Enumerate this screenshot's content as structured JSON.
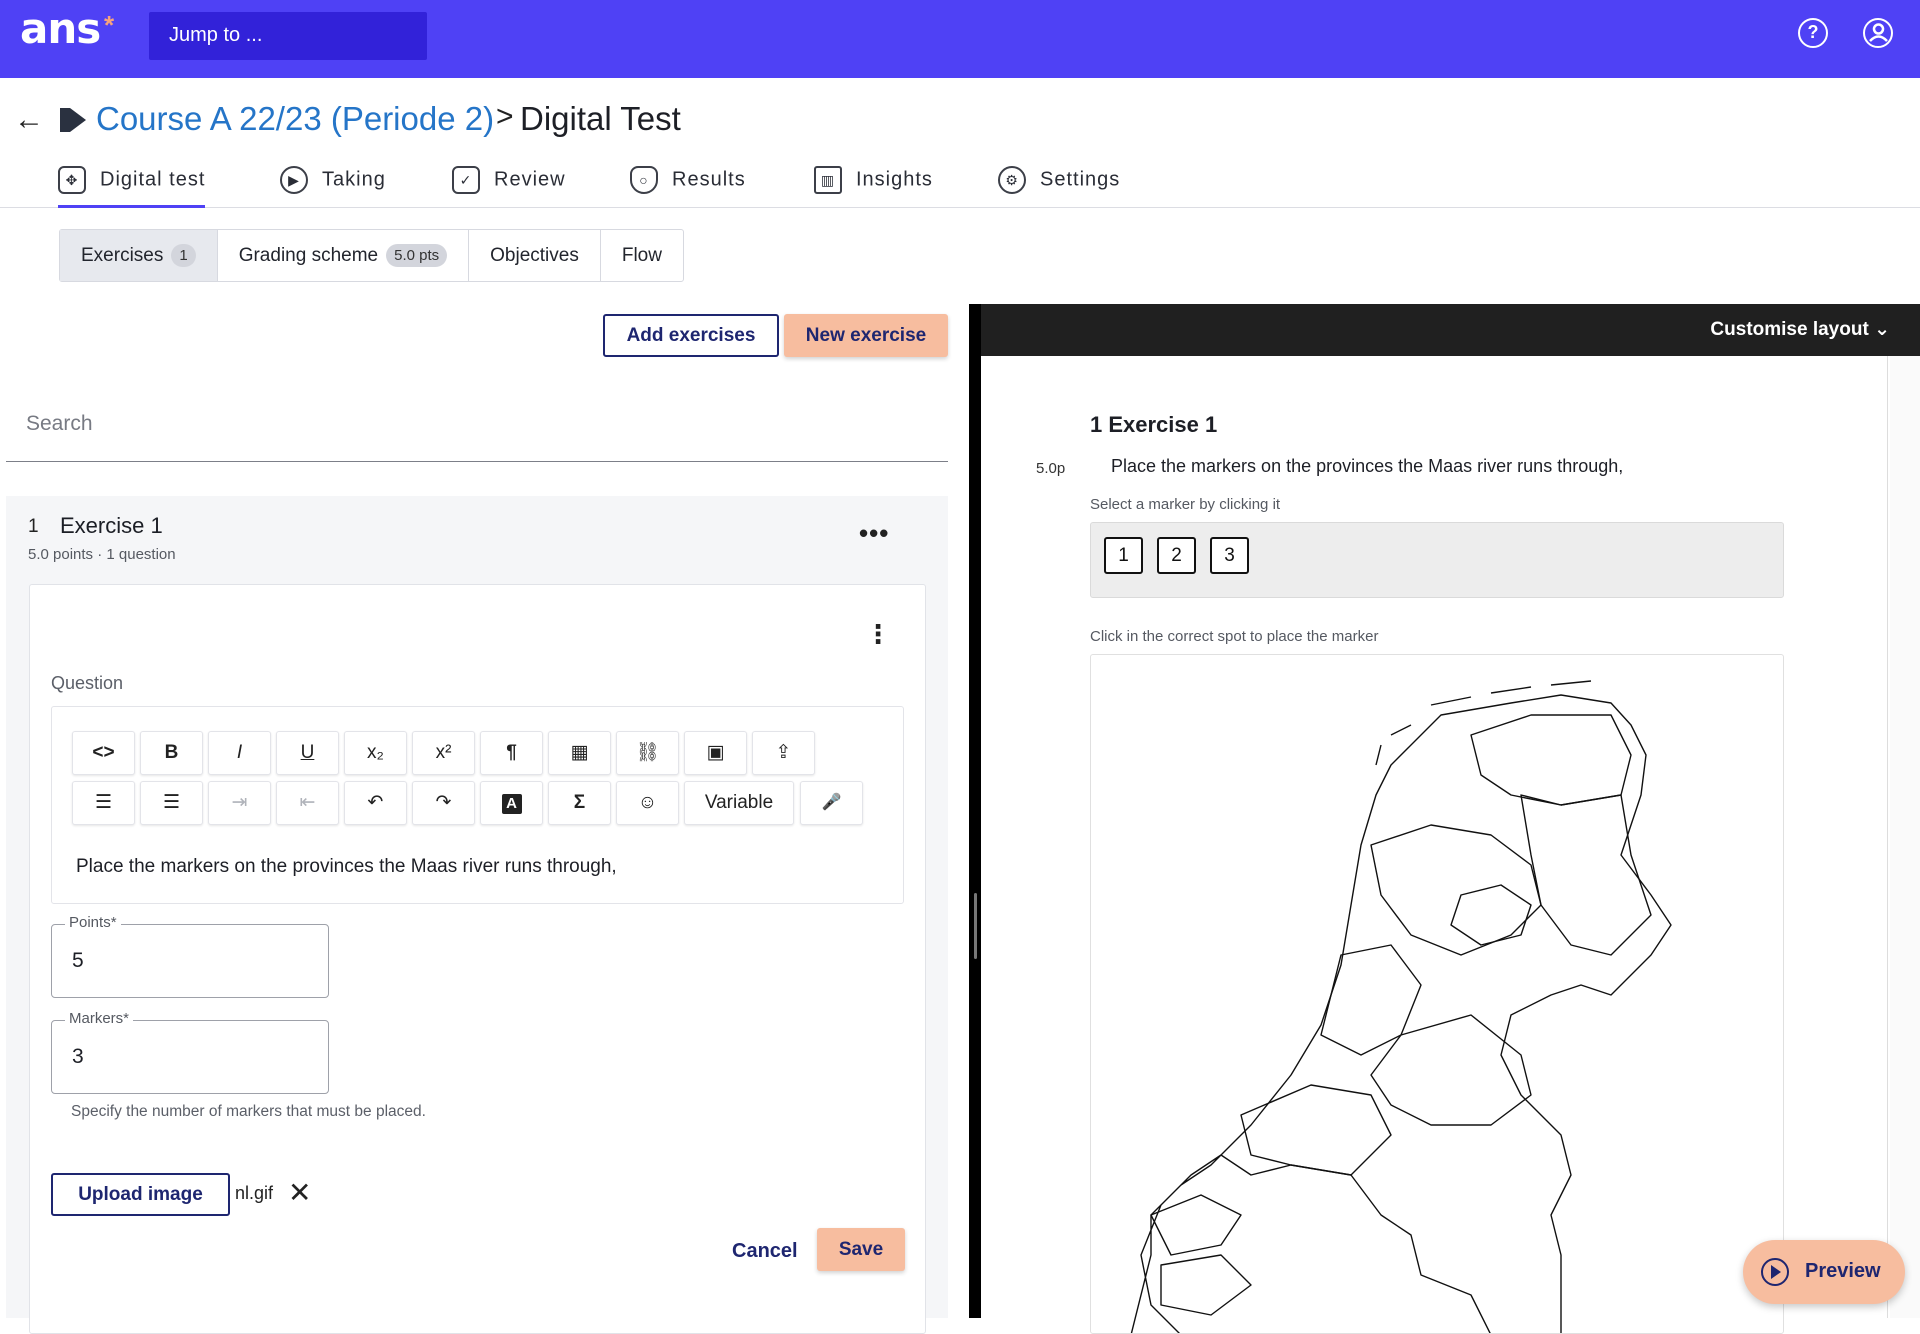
{
  "app": {
    "logo": "ans",
    "jump_placeholder": "Jump to ...",
    "colors": {
      "brand": "#4f41f5",
      "accent": "#f7bd9f",
      "link": "#2575c8",
      "navy": "#1e2670"
    }
  },
  "icons": {
    "help": "help-circle-icon",
    "account": "user-circle-icon"
  },
  "breadcrumb": {
    "course": "Course A 22/23 (Periode 2)",
    "separator": ">",
    "page": "Digital Test"
  },
  "tabs": [
    {
      "label": "Digital test",
      "icon": "puzzle-icon"
    },
    {
      "label": "Taking",
      "icon": "play-circle-icon"
    },
    {
      "label": "Review",
      "icon": "comment-check-icon"
    },
    {
      "label": "Results",
      "icon": "shield-icon"
    },
    {
      "label": "Insights",
      "icon": "bar-chart-icon"
    },
    {
      "label": "Settings",
      "icon": "gear-icon"
    }
  ],
  "subtabs": {
    "exercises": {
      "label": "Exercises",
      "count": "1"
    },
    "grading": {
      "label": "Grading scheme",
      "badge": "5.0 pts"
    },
    "objectives": {
      "label": "Objectives"
    },
    "flow": {
      "label": "Flow"
    }
  },
  "actions": {
    "add_exercises": "Add exercises",
    "new_exercise": "New exercise"
  },
  "search": {
    "placeholder": "Search"
  },
  "exercise": {
    "number": "1",
    "title": "Exercise 1",
    "meta": "5.0 points · 1 question",
    "more": "•••",
    "question_label": "Question",
    "toolbar": {
      "code": "<>",
      "bold": "B",
      "italic": "I",
      "underline": "U",
      "subscript": "x₂",
      "superscript": "x²",
      "paragraph": "¶",
      "table": "▦",
      "link": "⛓",
      "image": "▣",
      "embed": "⇪",
      "ordered_list": "☰",
      "bullet_list": "☰",
      "indent": "⇥",
      "outdent": "⇤",
      "undo": "↶",
      "redo": "↷",
      "text_color": "A",
      "formula": "Σ",
      "emoji": "☺",
      "variable": "Variable",
      "audio": "🎤"
    },
    "question_text": "Place the markers on the provinces the Maas river runs through,",
    "points_label": "Points*",
    "points_value": "5",
    "markers_label": "Markers*",
    "markers_value": "3",
    "markers_helper": "Specify the number of markers that must be placed.",
    "upload_label": "Upload image",
    "file_name": "nl.gif",
    "cancel": "Cancel",
    "save": "Save"
  },
  "preview": {
    "customise_layout": "Customise layout ⌄",
    "title": "1 Exercise 1",
    "points": "5.0p",
    "question": "Place the markers on the provinces the Maas river runs through,",
    "select_hint": "Select a marker by clicking it",
    "markers": [
      "1",
      "2",
      "3"
    ],
    "place_hint": "Click in the correct spot to place the marker",
    "button": "Preview"
  }
}
